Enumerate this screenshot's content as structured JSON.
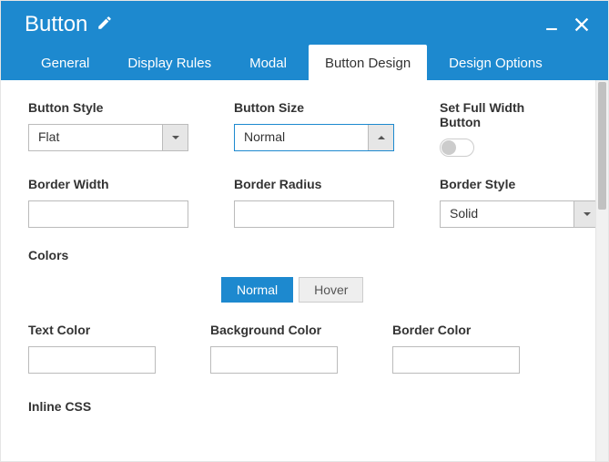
{
  "header": {
    "title": "Button"
  },
  "tabs": [
    {
      "label": "General"
    },
    {
      "label": "Display Rules"
    },
    {
      "label": "Modal"
    },
    {
      "label": "Button Design"
    },
    {
      "label": "Design Options"
    }
  ],
  "fields": {
    "button_style": {
      "label": "Button Style",
      "value": "Flat"
    },
    "button_size": {
      "label": "Button Size",
      "value": "Normal"
    },
    "full_width": {
      "label": "Set Full Width Button"
    },
    "border_width": {
      "label": "Border Width",
      "value": ""
    },
    "border_radius": {
      "label": "Border Radius",
      "value": ""
    },
    "border_style": {
      "label": "Border Style",
      "value": "Solid"
    },
    "colors_label": "Colors",
    "seg_normal": "Normal",
    "seg_hover": "Hover",
    "text_color": {
      "label": "Text Color"
    },
    "bg_color": {
      "label": "Background Color"
    },
    "border_color": {
      "label": "Border Color"
    },
    "inline_css": "Inline CSS"
  }
}
